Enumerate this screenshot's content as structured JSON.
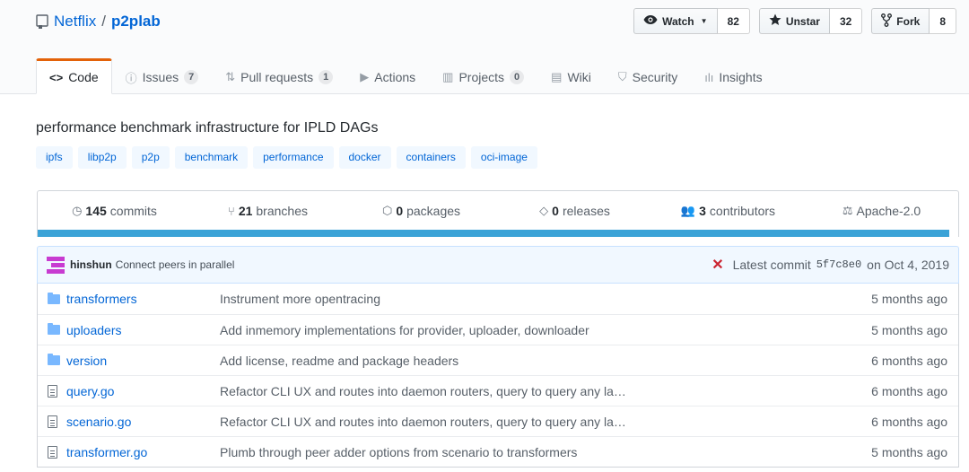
{
  "repo": {
    "owner": "Netflix",
    "separator": "/",
    "name": "p2plab"
  },
  "actions": {
    "watch_label": "Watch",
    "watch_count": "82",
    "star_label": "Unstar",
    "star_count": "32",
    "fork_label": "Fork",
    "fork_count": "8"
  },
  "tabs": [
    {
      "label": "Code",
      "icon": "code-icon",
      "counter": null,
      "selected": true
    },
    {
      "label": "Issues",
      "icon": "issue-icon",
      "counter": "7"
    },
    {
      "label": "Pull requests",
      "icon": "pull-request-icon",
      "counter": "1"
    },
    {
      "label": "Actions",
      "icon": "play-icon",
      "counter": null
    },
    {
      "label": "Projects",
      "icon": "project-icon",
      "counter": "0"
    },
    {
      "label": "Wiki",
      "icon": "book-icon",
      "counter": null
    },
    {
      "label": "Security",
      "icon": "shield-icon",
      "counter": null
    },
    {
      "label": "Insights",
      "icon": "graph-icon",
      "counter": null
    }
  ],
  "description": "performance benchmark infrastructure for IPLD DAGs",
  "topics": [
    "ipfs",
    "libp2p",
    "p2p",
    "benchmark",
    "performance",
    "docker",
    "containers",
    "oci-image"
  ],
  "summary": {
    "commits_num": "145",
    "commits_label": "commits",
    "branches_num": "21",
    "branches_label": "branches",
    "packages_num": "0",
    "packages_label": "packages",
    "releases_num": "0",
    "releases_label": "releases",
    "contributors_num": "3",
    "contributors_label": "contributors",
    "license": "Apache-2.0",
    "language_color": "#3ba3d7"
  },
  "latest_commit": {
    "author": "hinshun",
    "message": "Connect peers in parallel",
    "status_icon": "x-icon",
    "prefix": "Latest commit",
    "sha": "5f7c8e0",
    "date": "on Oct 4, 2019"
  },
  "files": [
    {
      "type": "folder",
      "name": "transformers",
      "message": "Instrument more opentracing",
      "age": "5 months ago"
    },
    {
      "type": "folder",
      "name": "uploaders",
      "message": "Add inmemory implementations for provider, uploader, downloader",
      "age": "5 months ago"
    },
    {
      "type": "folder",
      "name": "version",
      "message": "Add license, readme and package headers",
      "age": "6 months ago"
    },
    {
      "type": "file",
      "name": "query.go",
      "message": "Refactor CLI UX and routes into daemon routers, query to query any la…",
      "age": "6 months ago"
    },
    {
      "type": "file",
      "name": "scenario.go",
      "message": "Refactor CLI UX and routes into daemon routers, query to query any la…",
      "age": "6 months ago"
    },
    {
      "type": "file",
      "name": "transformer.go",
      "message": "Plumb through peer adder options from scenario to transformers",
      "age": "5 months ago"
    }
  ]
}
